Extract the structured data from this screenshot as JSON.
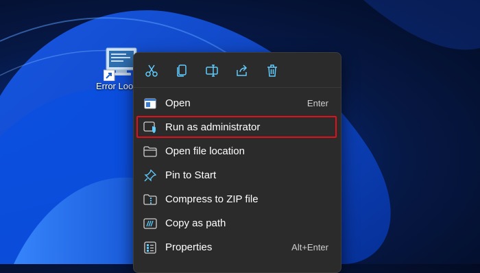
{
  "desktop": {
    "shortcut_label": "Error Loo"
  },
  "context_menu": {
    "toolbar": [
      {
        "name": "cut-icon"
      },
      {
        "name": "copy-icon"
      },
      {
        "name": "rename-icon"
      },
      {
        "name": "share-icon"
      },
      {
        "name": "delete-icon"
      }
    ],
    "items": [
      {
        "label": "Open",
        "shortcut": "Enter",
        "icon": "open-icon"
      },
      {
        "label": "Run as administrator",
        "shortcut": "",
        "icon": "shield-icon",
        "highlighted": true
      },
      {
        "label": "Open file location",
        "shortcut": "",
        "icon": "folder-icon"
      },
      {
        "label": "Pin to Start",
        "shortcut": "",
        "icon": "pin-icon"
      },
      {
        "label": "Compress to ZIP file",
        "shortcut": "",
        "icon": "zip-icon"
      },
      {
        "label": "Copy as path",
        "shortcut": "",
        "icon": "copy-path-icon"
      },
      {
        "label": "Properties",
        "shortcut": "Alt+Enter",
        "icon": "properties-icon"
      }
    ]
  },
  "colors": {
    "highlight_border": "#e0101d",
    "menu_background": "#2b2b2b",
    "icon_accent": "#60cdff"
  }
}
